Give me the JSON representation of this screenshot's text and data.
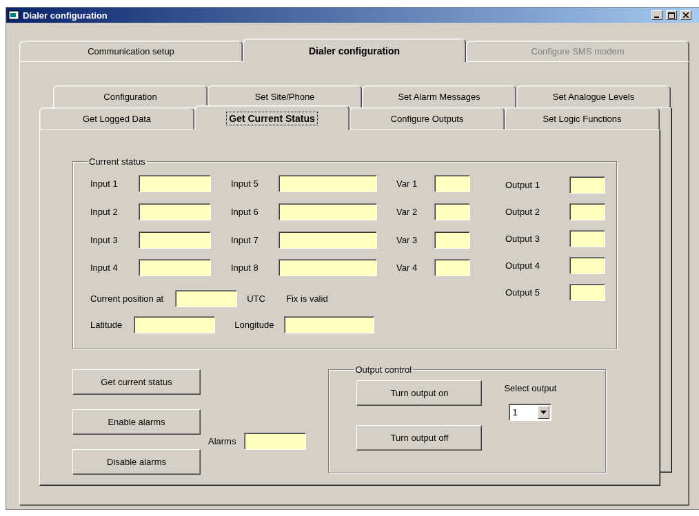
{
  "window": {
    "title": "Dialer configuration"
  },
  "outer_tabs": [
    {
      "label": "Communication setup",
      "selected": false,
      "disabled": false
    },
    {
      "label": "Dialer configuration",
      "selected": true,
      "disabled": false
    },
    {
      "label": "Configure SMS modem",
      "selected": false,
      "disabled": true
    }
  ],
  "inner_tabs_back": [
    {
      "label": "Configuration",
      "selected": false
    },
    {
      "label": "Set Site/Phone",
      "selected": false
    },
    {
      "label": "Set Alarm Messages",
      "selected": false
    },
    {
      "label": "Set Analogue Levels",
      "selected": false
    }
  ],
  "inner_tabs_front": [
    {
      "label": "Get Logged Data",
      "selected": false
    },
    {
      "label": "Get Current Status",
      "selected": true
    },
    {
      "label": "Configure Outputs",
      "selected": false
    },
    {
      "label": "Set Logic Functions",
      "selected": false
    }
  ],
  "current_status": {
    "title": "Current status",
    "columns": [
      [
        {
          "label": "Input 1"
        },
        {
          "label": "Input 2"
        },
        {
          "label": "Input 3"
        },
        {
          "label": "Input 4"
        }
      ],
      [
        {
          "label": "Input 5"
        },
        {
          "label": "Input 6"
        },
        {
          "label": "Input 7"
        },
        {
          "label": "Input 8"
        }
      ],
      [
        {
          "label": "Var 1"
        },
        {
          "label": "Var 2"
        },
        {
          "label": "Var 3"
        },
        {
          "label": "Var 4"
        }
      ]
    ],
    "outputs": [
      {
        "label": "Output 1"
      },
      {
        "label": "Output 2"
      },
      {
        "label": "Output 3"
      },
      {
        "label": "Output 4"
      },
      {
        "label": "Output 5"
      }
    ],
    "position_label": "Current position at",
    "utc_label": "UTC",
    "fix_label": "Fix is valid",
    "latitude_label": "Latitude",
    "longitude_label": "Longitude"
  },
  "actions": [
    "Get current status",
    "Enable alarms",
    "Disable alarms"
  ],
  "alarms_label": "Alarms",
  "output_control": {
    "title": "Output control",
    "buttons": [
      "Turn output on",
      "Turn output off"
    ],
    "select_label": "Select output",
    "select_value": "1"
  }
}
